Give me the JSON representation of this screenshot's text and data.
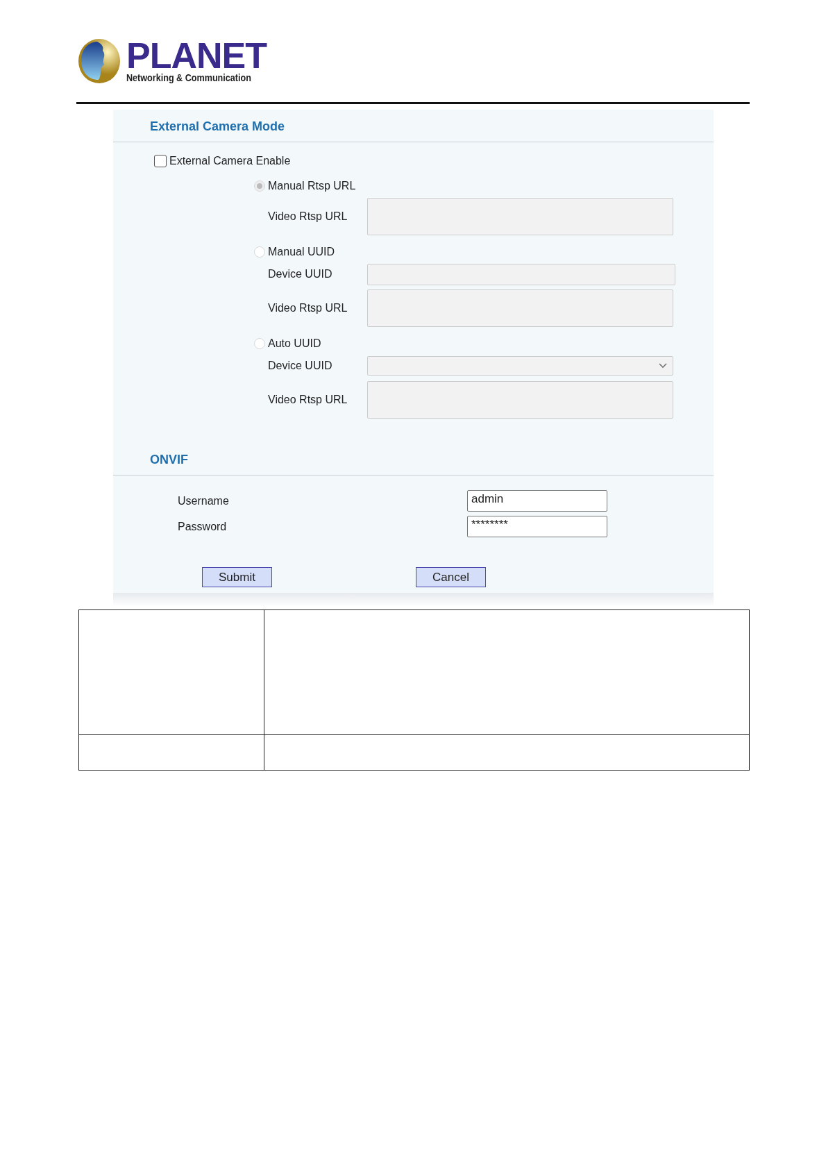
{
  "logo": {
    "name": "PLANET",
    "tagline": "Networking & Communication"
  },
  "external_camera": {
    "title": "External Camera Mode",
    "enable": {
      "label": "External Camera Enable",
      "checked": false
    },
    "options": [
      {
        "label": "Manual Rtsp URL",
        "selected": true,
        "disabled": true,
        "fields": [
          {
            "label": "Video Rtsp URL",
            "kind": "textarea"
          }
        ]
      },
      {
        "label": "Manual UUID",
        "selected": false,
        "disabled": true,
        "fields": [
          {
            "label": "Device UUID",
            "kind": "text"
          },
          {
            "label": "Video Rtsp URL",
            "kind": "textarea"
          }
        ]
      },
      {
        "label": "Auto UUID",
        "selected": false,
        "disabled": true,
        "fields": [
          {
            "label": "Device UUID",
            "kind": "select"
          },
          {
            "label": "Video Rtsp URL",
            "kind": "textarea"
          }
        ]
      }
    ]
  },
  "onvif": {
    "title": "ONVIF",
    "fields": [
      {
        "label": "Username",
        "value": "admin"
      },
      {
        "label": "Password",
        "value": "********"
      }
    ]
  },
  "buttons": [
    "Submit",
    "Cancel"
  ]
}
